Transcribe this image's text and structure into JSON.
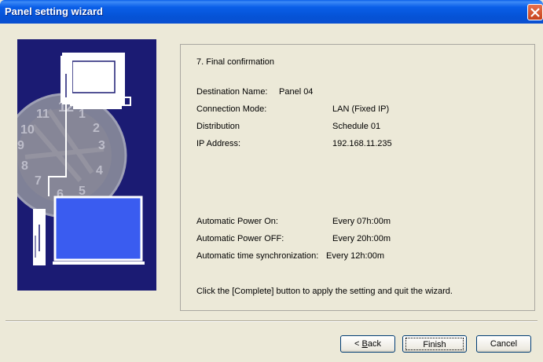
{
  "window": {
    "title": "Panel setting wizard",
    "close_icon": "close-icon"
  },
  "step": {
    "heading": "7. Final confirmation"
  },
  "summary": {
    "destination_label": "Destination Name:",
    "destination_value": "Panel 04",
    "connection_label": "Connection Mode:",
    "connection_value": "LAN (Fixed IP)",
    "distribution_label": "Distribution",
    "distribution_value": "Schedule 01",
    "ip_label": "IP Address:",
    "ip_value": "192.168.11.235",
    "power_on_label": "Automatic Power On:",
    "power_on_value": "Every 07h:00m",
    "power_off_label": "Automatic Power OFF:",
    "power_off_value": "Every 20h:00m",
    "sync_label": "Automatic time synchronization:",
    "sync_value": "Every 12h:00m",
    "instruction": "Click the [Complete] button to apply the setting and quit the wizard."
  },
  "buttons": {
    "back_prefix": "< ",
    "back_mnemonic": "B",
    "back_rest": "ack",
    "finish": "Finish",
    "cancel": "Cancel"
  },
  "colors": {
    "title_bar": "#0a5fe8",
    "art_background": "#1b1b73",
    "monitor_screen": "#3a5cf0",
    "close_button": "#c6421c"
  }
}
